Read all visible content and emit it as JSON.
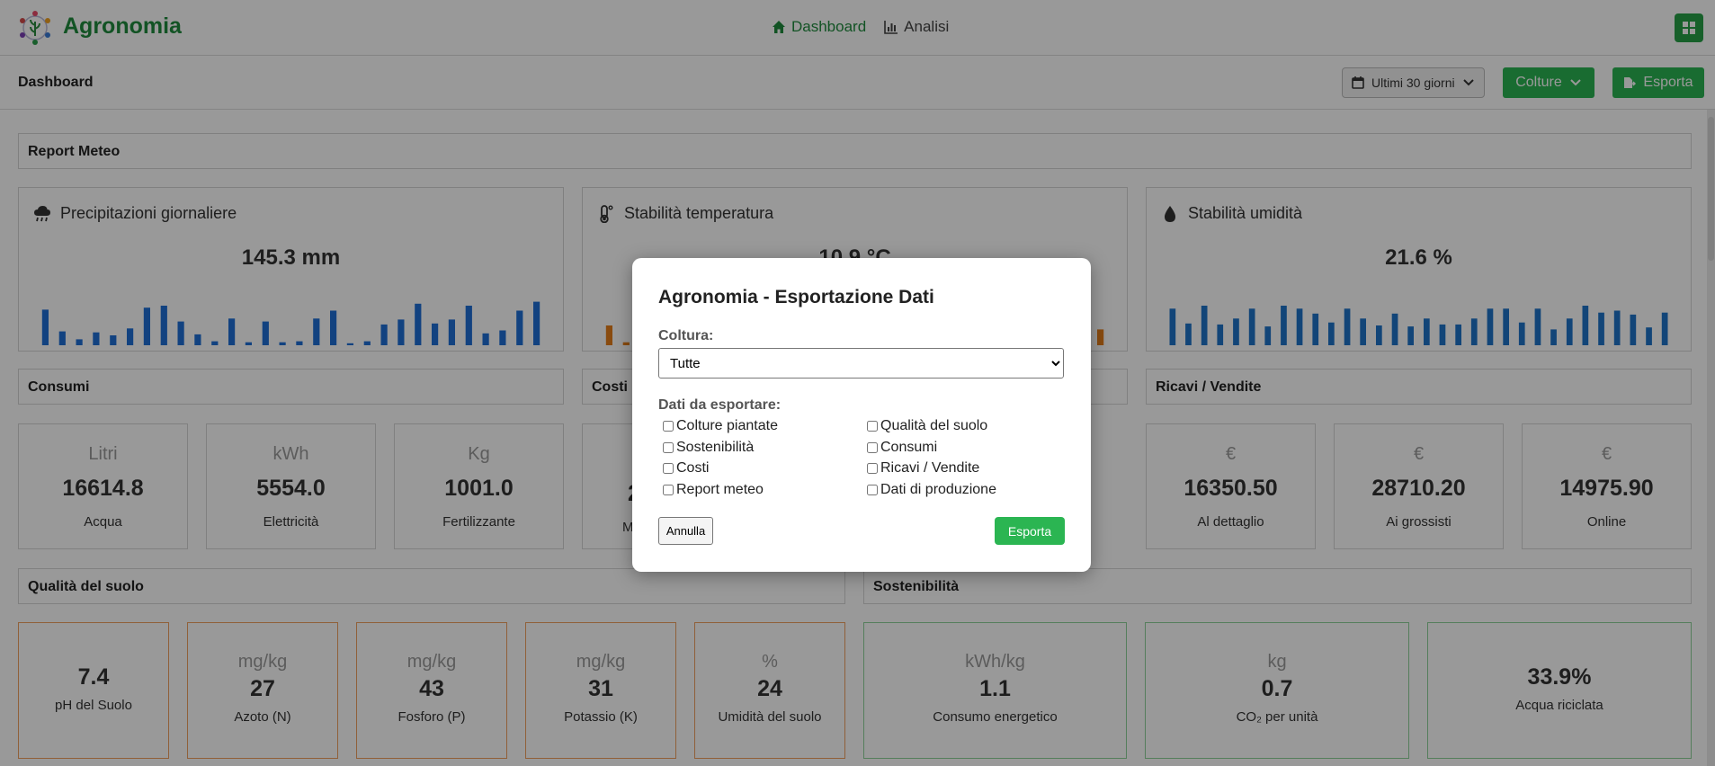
{
  "nav": {
    "brand": "Agronomia",
    "links": [
      {
        "label": "Dashboard",
        "icon": "home-icon",
        "active": true
      },
      {
        "label": "Analisi",
        "icon": "bar-chart-icon",
        "active": false
      }
    ]
  },
  "toolbar": {
    "title": "Dashboard",
    "range_label": "Ultimi 30 giorni",
    "colture_label": "Colture",
    "esporta_label": "Esporta"
  },
  "sections": {
    "meteo": "Report Meteo",
    "consumi": "Consumi",
    "costi": "Costi",
    "ricavi": "Ricavi / Vendite",
    "suolo": "Qualità del suolo",
    "sostenibilita": "Sostenibilità"
  },
  "weather": [
    {
      "title": "Precipitazioni giornaliere",
      "value": "145.3 mm",
      "icon": "cloud-rain-icon",
      "color": "#1f6fd6",
      "bars": [
        36,
        14,
        6,
        13,
        10,
        17,
        38,
        40,
        24,
        11,
        4,
        27,
        3,
        24,
        3,
        4,
        27,
        35,
        2,
        4,
        21,
        26,
        42,
        22,
        26,
        40,
        12,
        15,
        35,
        44
      ]
    },
    {
      "title": "Stabilità temperatura",
      "value": "10.9 °C",
      "icon": "thermometer-icon",
      "color": "#e57d1a",
      "bars": [
        20,
        3,
        2,
        2,
        2,
        2,
        2,
        2,
        2,
        2,
        2,
        2,
        2,
        2,
        2,
        2,
        2,
        2,
        2,
        2,
        2,
        2,
        2,
        2,
        2,
        2,
        2,
        2,
        2,
        16
      ]
    },
    {
      "title": "Stabilità umidità",
      "value": "21.6 %",
      "icon": "water-drop-icon",
      "color": "#1f73c8",
      "bars": [
        37,
        22,
        40,
        21,
        27,
        37,
        19,
        40,
        37,
        32,
        23,
        37,
        27,
        20,
        32,
        19,
        27,
        21,
        21,
        27,
        37,
        37,
        23,
        37,
        16,
        27,
        40,
        33,
        35,
        31,
        18,
        33
      ]
    }
  ],
  "consumi": [
    {
      "unit": "Litri",
      "value": "16614.8",
      "label": "Acqua"
    },
    {
      "unit": "kWh",
      "value": "5554.0",
      "label": "Elettricità"
    },
    {
      "unit": "Kg",
      "value": "1001.0",
      "label": "Fertilizzante"
    }
  ],
  "costi_partial": {
    "value": "2",
    "label": "M"
  },
  "ricavi": [
    {
      "unit": "€",
      "value": "16350.50",
      "label": "Al dettaglio"
    },
    {
      "unit": "€",
      "value": "28710.20",
      "label": "Ai grossisti"
    },
    {
      "unit": "€",
      "value": "14975.90",
      "label": "Online"
    }
  ],
  "suolo": [
    {
      "unit": "",
      "value": "7.4",
      "label": "pH del Suolo"
    },
    {
      "unit": "mg/kg",
      "value": "27",
      "label": "Azoto (N)"
    },
    {
      "unit": "mg/kg",
      "value": "43",
      "label": "Fosforo (P)"
    },
    {
      "unit": "mg/kg",
      "value": "31",
      "label": "Potassio (K)"
    },
    {
      "unit": "%",
      "value": "24",
      "label": "Umidità del suolo"
    }
  ],
  "sostenibilita": [
    {
      "unit": "kWh/kg",
      "value": "1.1",
      "label": "Consumo energetico"
    },
    {
      "unit": "kg",
      "value": "0.7",
      "label": "CO₂ per unità"
    },
    {
      "unit": "",
      "value": "33.9%",
      "label": "Acqua riciclata"
    }
  ],
  "modal": {
    "title": "Agronomia - Esportazione Dati",
    "coltura_label": "Coltura:",
    "coltura_value": "Tutte",
    "dati_label": "Dati da esportare:",
    "options": [
      "Colture piantate",
      "Qualità del suolo",
      "Sostenibilità",
      "Consumi",
      "Costi",
      "Ricavi / Vendite",
      "Report meteo",
      "Dati di produzione"
    ],
    "cancel_label": "Annulla",
    "export_label": "Esporta"
  },
  "colors": {
    "brand": "#1f8a3d",
    "accent": "#2bb552",
    "orange_border": "#f0a060",
    "green_border": "#8ed29a"
  }
}
